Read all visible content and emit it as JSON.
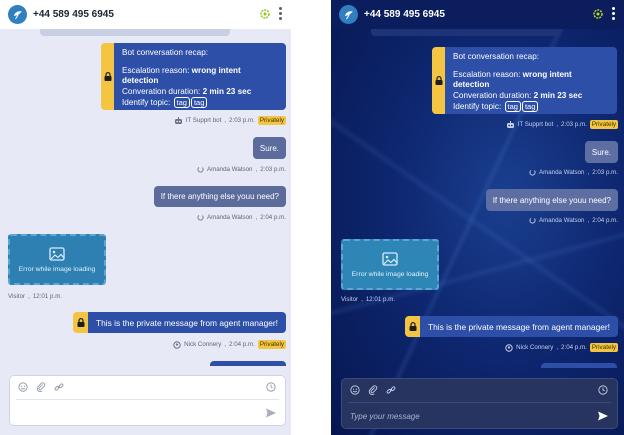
{
  "header": {
    "phone": "+44 589 495 6945"
  },
  "recap": {
    "title": "Bot conversation recap:",
    "escalation_label": "Escalation reason:",
    "escalation_value": "wrong intent detection",
    "duration_label": "Converation duration:",
    "duration_value": "2 min 23 sec",
    "topic_label": "Identify topic:",
    "tags": [
      "tag",
      "tag"
    ]
  },
  "recap_meta": {
    "sender": "IT Supprt bot",
    "time": "2:03 p.m.",
    "privacy": "Privately"
  },
  "messages": [
    {
      "text": "Sure.",
      "sender": "Amanda Watson",
      "time": "2:03 p.m."
    },
    {
      "text": "If there anything else youu need?",
      "sender": "Amanda Watson",
      "time": "2:04 p.m."
    }
  ],
  "image_error": {
    "label": "Error while image loading",
    "sender": "Visitor",
    "time": "12:01 p.m."
  },
  "private_message": {
    "text": "This is the private message from agent manager!",
    "sender": "Nick Connery",
    "time": "2:04 p.m.",
    "privacy": "Privately"
  },
  "composer": {
    "placeholder": "Type your message"
  },
  "colors": {
    "accent": "#2d4fa7",
    "private": "#f4c542",
    "agent_bubble": "#5b6c9c",
    "image_tile": "#2e7fb2"
  }
}
